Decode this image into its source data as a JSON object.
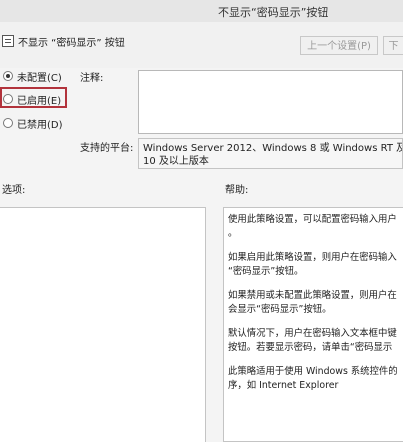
{
  "window": {
    "title": "不显示“密码显示”按钮"
  },
  "policy": {
    "name": "不显示 “密码显示” 按钮"
  },
  "nav": {
    "prev_label": "上一个设置(P)",
    "next_label": "下"
  },
  "state_options": [
    {
      "label": "未配置(C)",
      "checked": true
    },
    {
      "label": "已启用(E)",
      "checked": false
    },
    {
      "label": "已禁用(D)",
      "checked": false
    }
  ],
  "comment": {
    "label": "注释:",
    "value": ""
  },
  "platform": {
    "label": "支持的平台:",
    "line1": "Windows Server 2012、Windows 8 或 Windows RT 及以上",
    "line2": "10 及以上版本"
  },
  "options": {
    "label": "选项:"
  },
  "help": {
    "label": "帮助:",
    "paragraphs": [
      [
        "使用此策略设置，可以配置密码输入用户",
        "。"
      ],
      [
        "如果启用此策略设置，则用户在密码输入",
        "“密码显示”按钮。"
      ],
      [
        "如果禁用或未配置此策略设置，则用户在",
        "会显示“密码显示”按钮。"
      ],
      [
        "默认情况下，用户在密码输入文本框中键",
        "按钮。若要显示密码，请单击“密码显示"
      ],
      [
        "此策略适用于使用 Windows 系统控件的",
        "序，如 Internet Explorer"
      ]
    ]
  }
}
